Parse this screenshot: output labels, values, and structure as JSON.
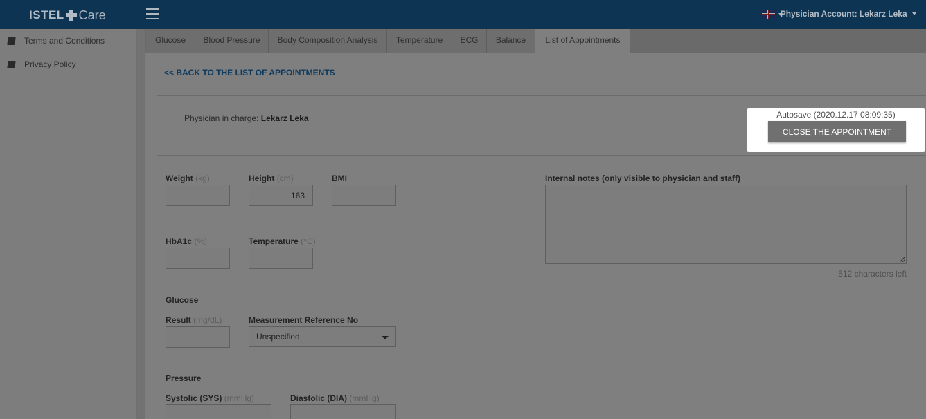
{
  "header": {
    "logo_text": "ISTEL",
    "logo_suffix": "Care",
    "account_label": "Physician Account: Lekarz Leka",
    "language_flag": "uk-flag-icon"
  },
  "sidebar": {
    "items": [
      {
        "label": "Terms and Conditions",
        "icon": "book-icon"
      },
      {
        "label": "Privacy Policy",
        "icon": "book-icon"
      }
    ]
  },
  "tabs": [
    {
      "label": "Glucose"
    },
    {
      "label": "Blood Pressure"
    },
    {
      "label": "Body Composition Analysis"
    },
    {
      "label": "Temperature"
    },
    {
      "label": "ECG"
    },
    {
      "label": "Balance"
    },
    {
      "label": "List of Appointments",
      "active": true
    }
  ],
  "main": {
    "back_link": "<< BACK TO THE LIST OF APPOINTMENTS",
    "physician_prefix": "Physician in charge: ",
    "physician_name": "Lekarz Leka",
    "autosave": "Autosave (2020.12.17 08:09:35)",
    "close_button": "CLOSE THE APPOINTMENT"
  },
  "form": {
    "weight": {
      "label": "Weight",
      "unit": "(kg)",
      "value": ""
    },
    "height": {
      "label": "Height",
      "unit": "(cm)",
      "value": "163"
    },
    "bmi": {
      "label": "BMI",
      "value": ""
    },
    "hba1c": {
      "label": "HbA1c",
      "unit": "(%)",
      "value": ""
    },
    "temperature": {
      "label": "Temperature",
      "unit": "(°C)",
      "value": ""
    },
    "glucose_section": "Glucose",
    "glucose_result": {
      "label": "Result",
      "unit": "(mg/dL)",
      "value": ""
    },
    "measurement_ref": {
      "label": "Measurement Reference No",
      "selected": "Unspecified"
    },
    "pressure_section": "Pressure",
    "systolic": {
      "label": "Systolic (SYS)",
      "unit": "(mmHg)",
      "value": ""
    },
    "diastolic": {
      "label": "Diastolic (DIA)",
      "unit": "(mmHg)",
      "value": ""
    },
    "notes": {
      "label": "Internal notes (only visible to physician and staff)",
      "value": "",
      "chars_left": "512 characters left"
    }
  }
}
